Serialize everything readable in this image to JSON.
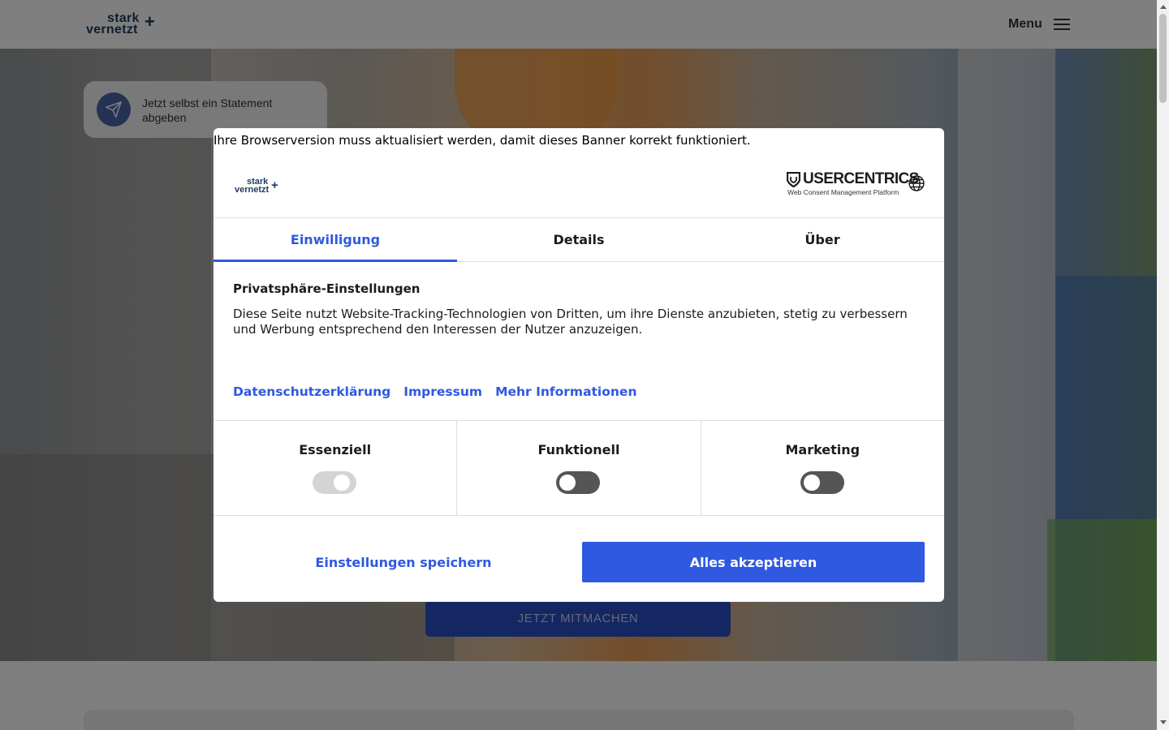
{
  "site": {
    "logo_line1": "stark",
    "logo_line2": "vernetzt",
    "logo_plus": "+",
    "menu_label": "Menu",
    "statement_text": "Jetzt selbst ein Statement abgeben",
    "cta_label": "JETZT MITMACHEN"
  },
  "consent": {
    "browser_warning": "Ihre Browserversion muss aktualisiert werden, damit dieses Banner korrekt funktioniert.",
    "provider_name": "USERCENTRICS",
    "provider_tagline": "Web Consent Management Platform",
    "tabs": [
      {
        "label": "Einwilligung",
        "active": true
      },
      {
        "label": "Details",
        "active": false
      },
      {
        "label": "Über",
        "active": false
      }
    ],
    "section_title": "Privatsphäre-Einstellungen",
    "section_description": "Diese Seite nutzt Website-Tracking-Technologien von Dritten, um ihre Dienste anzubieten, stetig zu verbessern und Werbung entsprechend den Interessen der Nutzer anzuzeigen.",
    "links": [
      "Datenschutzerklärung",
      "Impressum",
      "Mehr Informationen"
    ],
    "categories": [
      {
        "label": "Essenziell",
        "enabled": true,
        "locked": true
      },
      {
        "label": "Funktionell",
        "enabled": false,
        "locked": false
      },
      {
        "label": "Marketing",
        "enabled": false,
        "locked": false
      }
    ],
    "save_label": "Einstellungen speichern",
    "accept_label": "Alles akzeptieren"
  },
  "colors": {
    "accent": "#2f59e0",
    "toggle_off": "#555555",
    "toggle_locked": "#d4d4d4",
    "brand_navy": "#1f3a5f"
  },
  "icons": {
    "menu": "hamburger-icon",
    "statement": "paper-plane-icon",
    "language": "globe-icon",
    "provider": "shield-icon"
  }
}
